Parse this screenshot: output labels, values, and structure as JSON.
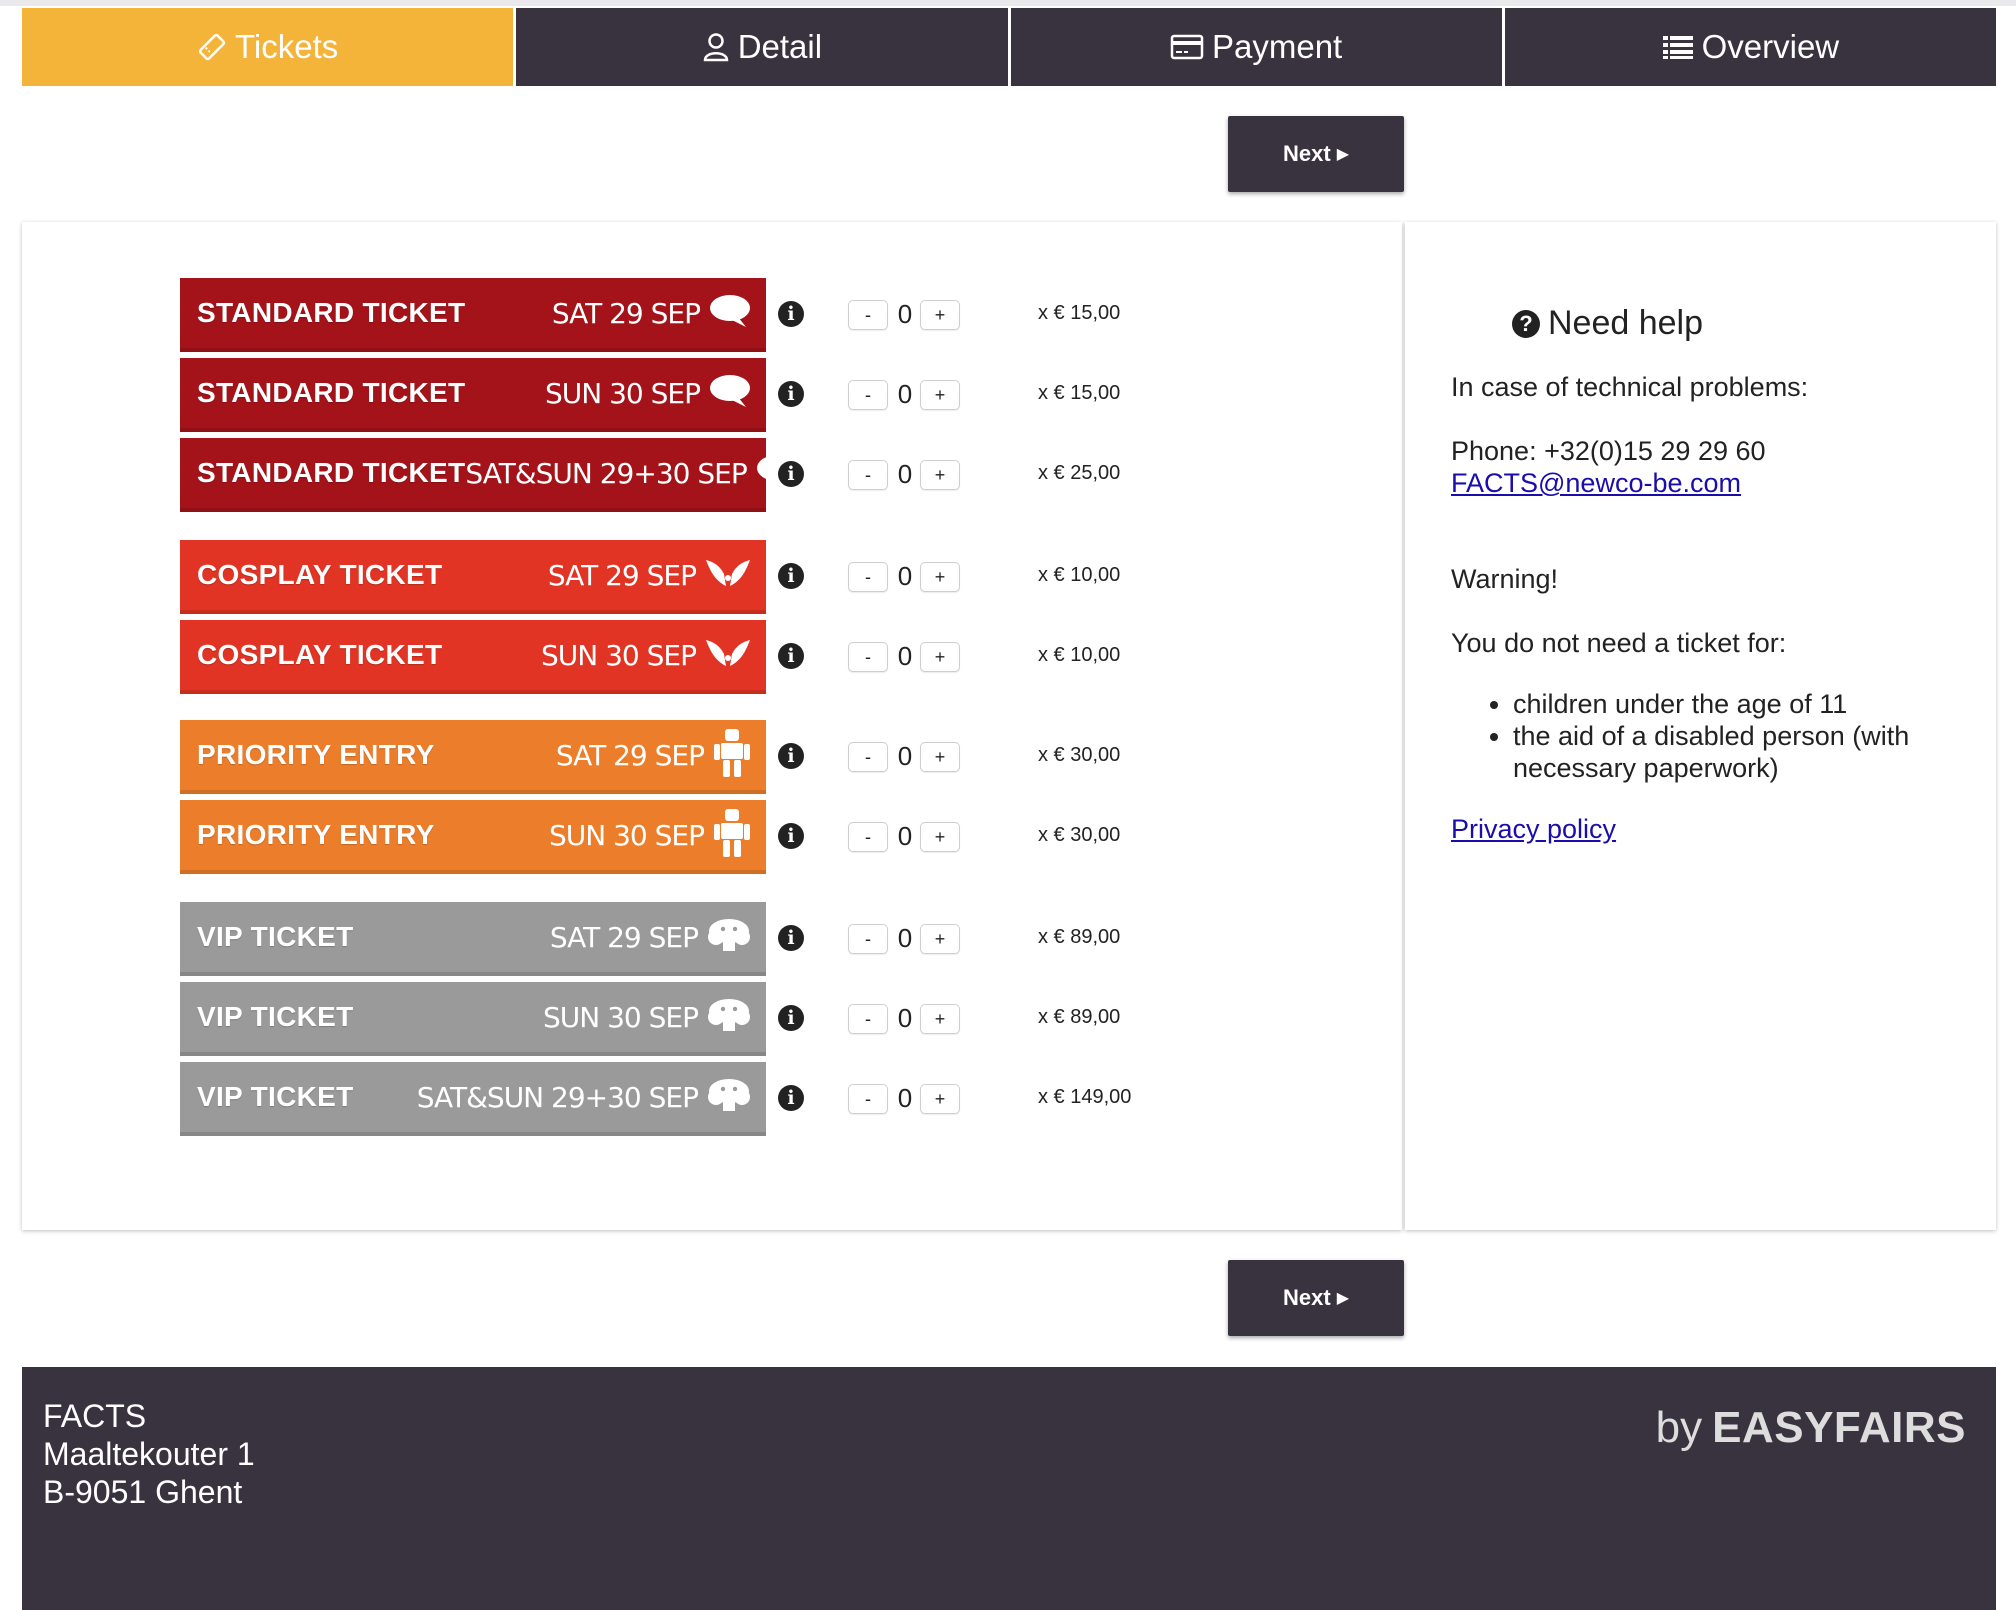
{
  "tabs": [
    {
      "label": "Tickets",
      "icon": "ticket-icon",
      "active": true
    },
    {
      "label": "Detail",
      "icon": "user-icon",
      "active": false
    },
    {
      "label": "Payment",
      "icon": "credit-card-icon",
      "active": false
    },
    {
      "label": "Overview",
      "icon": "list-icon",
      "active": false
    }
  ],
  "next_button": {
    "label": "Next",
    "icon": "caret-right-icon"
  },
  "colors": {
    "tab_active": "#f4b43a",
    "dark": "#38333f",
    "standard": "#a31319",
    "cosplay": "#e23424",
    "priority": "#ec7e2b",
    "vip": "#9a9a9a"
  },
  "tickets": [
    {
      "name": "STANDARD TICKET",
      "date": "SAT 29 SEP",
      "icon": "speech-bubble-icon",
      "qty": "0",
      "price": "x € 15,00",
      "minus": "-",
      "plus": "+"
    },
    {
      "name": "STANDARD TICKET",
      "date": "SUN 30 SEP",
      "icon": "speech-bubble-icon",
      "qty": "0",
      "price": "x € 15,00",
      "minus": "-",
      "plus": "+"
    },
    {
      "name": "STANDARD TICKET",
      "date": "SAT&SUN 29+30 SEP",
      "icon": "speech-bubble-icon",
      "qty": "0",
      "price": "x € 25,00",
      "minus": "-",
      "plus": "+"
    },
    {
      "name": "COSPLAY TICKET",
      "date": "SAT 29 SEP",
      "icon": "wings-icon",
      "qty": "0",
      "price": "x € 10,00",
      "minus": "-",
      "plus": "+"
    },
    {
      "name": "COSPLAY TICKET",
      "date": "SUN 30 SEP",
      "icon": "wings-icon",
      "qty": "0",
      "price": "x € 10,00",
      "minus": "-",
      "plus": "+"
    },
    {
      "name": "PRIORITY ENTRY",
      "date": "SAT 29 SEP",
      "icon": "robot-icon",
      "qty": "0",
      "price": "x € 30,00",
      "minus": "-",
      "plus": "+"
    },
    {
      "name": "PRIORITY ENTRY",
      "date": "SUN 30 SEP",
      "icon": "robot-icon",
      "qty": "0",
      "price": "x € 30,00",
      "minus": "-",
      "plus": "+"
    },
    {
      "name": "VIP TICKET",
      "date": "SAT 29 SEP",
      "icon": "mushroom-cloud-icon",
      "qty": "0",
      "price": "x € 89,00",
      "minus": "-",
      "plus": "+"
    },
    {
      "name": "VIP TICKET",
      "date": "SUN 30 SEP",
      "icon": "mushroom-cloud-icon",
      "qty": "0",
      "price": "x € 89,00",
      "minus": "-",
      "plus": "+"
    },
    {
      "name": "VIP TICKET",
      "date": "SAT&SUN 29+30 SEP",
      "icon": "mushroom-cloud-icon",
      "qty": "0",
      "price": "x € 149,00",
      "minus": "-",
      "plus": "+"
    }
  ],
  "help": {
    "title": "Need help",
    "title_icon": "question-circle-icon",
    "tech_problems": "In case of technical problems:",
    "phone": "Phone: +32(0)15 29 29 60",
    "email": "FACTS@newco-be.com",
    "warning": "Warning!",
    "no_ticket_for": "You do not need a ticket for:",
    "exemptions": [
      "children under the age of 11",
      "the aid of a disabled person (with",
      "necessary paperwork)"
    ],
    "privacy": "Privacy policy"
  },
  "footer": {
    "org": "FACTS",
    "street": "Maaltekouter 1",
    "city": "B-9051 Ghent",
    "brand_by": "by",
    "brand_name": "EASYFAIRS"
  }
}
